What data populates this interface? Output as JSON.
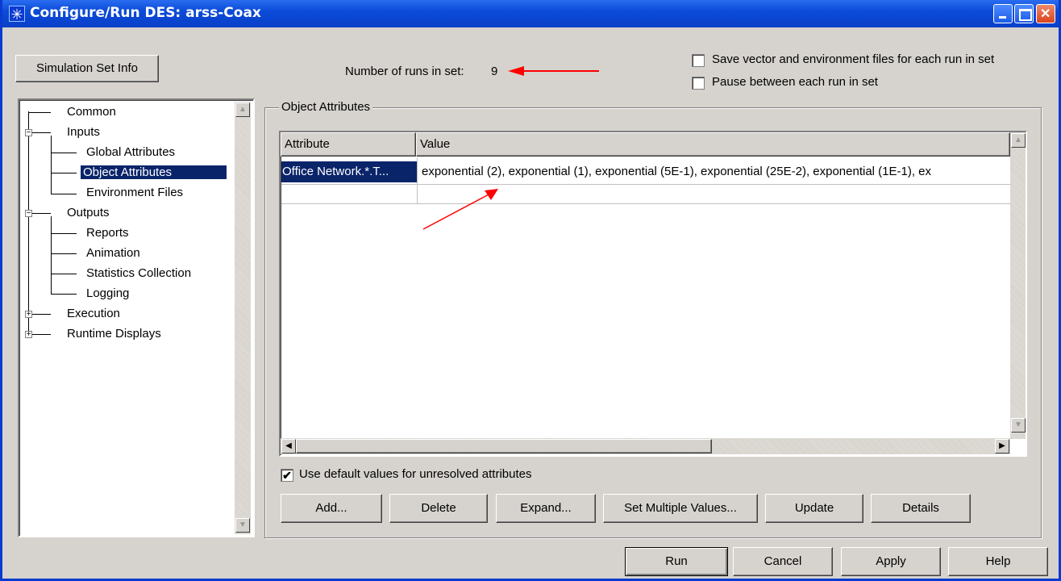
{
  "window": {
    "title": "Configure/Run DES: arss-Coax",
    "icon": "asterisk-app-icon"
  },
  "top": {
    "sim_set_info_label": "Simulation Set Info",
    "runs_label": "Number of runs in set:",
    "runs_value": "9",
    "save_vector_label": "Save vector and environment files for each run in set",
    "save_vector_checked": false,
    "pause_label": "Pause between each run in set",
    "pause_checked": false
  },
  "tree": {
    "items": [
      {
        "label": "Common"
      },
      {
        "label": "Inputs"
      },
      {
        "label": "Global Attributes"
      },
      {
        "label": "Object Attributes"
      },
      {
        "label": "Environment Files"
      },
      {
        "label": "Outputs"
      },
      {
        "label": "Reports"
      },
      {
        "label": "Animation"
      },
      {
        "label": "Statistics Collection"
      },
      {
        "label": "Logging"
      },
      {
        "label": "Execution"
      },
      {
        "label": "Runtime Displays"
      }
    ],
    "selected": "Object Attributes"
  },
  "panel": {
    "group_title": "Object Attributes",
    "columns": [
      "Attribute",
      "Value"
    ],
    "rows": [
      {
        "attribute": "Office Network.*.T...",
        "value": "exponential (2), exponential (1), exponential (5E-1), exponential (25E-2), exponential (1E-1), ex"
      }
    ],
    "use_default_label": "Use default values for unresolved attributes",
    "use_default_checked": true,
    "buttons": [
      "Add...",
      "Delete",
      "Expand...",
      "Set Multiple Values...",
      "Update",
      "Details"
    ]
  },
  "footer": {
    "buttons": [
      "Run",
      "Cancel",
      "Apply",
      "Help"
    ]
  },
  "colors": {
    "titlebar": "#0b4bd8",
    "dialog_bg": "#d6d3ce",
    "selection": "#0a246a",
    "annotation_arrow": "#ff0000"
  }
}
